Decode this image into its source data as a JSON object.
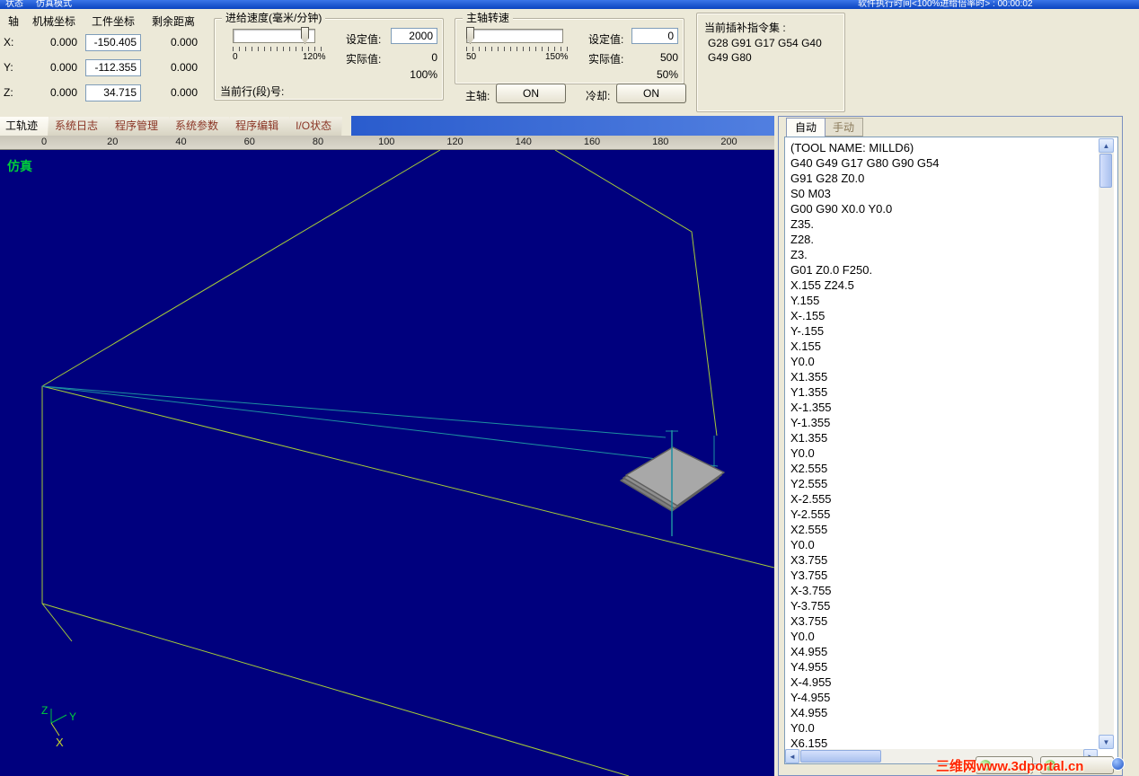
{
  "titlebar": {
    "status": "状态",
    "mode": "仿真模式",
    "exec_info": "软件执行时间<100%进给倍率时> : 00:00:02"
  },
  "coords": {
    "headers": [
      "轴",
      "机械坐标",
      "工件坐标",
      "剩余距离"
    ],
    "rows": [
      {
        "axis": "X:",
        "machine": "0.000",
        "work": "-150.405",
        "remain": "0.000"
      },
      {
        "axis": "Y:",
        "machine": "0.000",
        "work": "-112.355",
        "remain": "0.000"
      },
      {
        "axis": "Z:",
        "machine": "0.000",
        "work": "34.715",
        "remain": "0.000"
      }
    ]
  },
  "feed": {
    "title": "进给速度(毫米/分钟)",
    "slider_min": "0",
    "slider_max": "120%",
    "set_label": "设定值:",
    "set_value": "2000",
    "actual_label": "实际值:",
    "actual_value": "0",
    "percent": "100%",
    "current_line_label": "当前行(段)号:"
  },
  "spindle": {
    "title": "主轴转速",
    "slider_min": "50",
    "slider_max": "150%",
    "set_label": "设定值:",
    "set_value": "0",
    "actual_label": "实际值:",
    "actual_value": "500",
    "percent": "50%",
    "spindle_label": "主轴:",
    "spindle_btn": "ON",
    "coolant_label": "冷却:",
    "coolant_btn": "ON"
  },
  "gcode_panel": {
    "title": "当前插补指令集 :",
    "lines": [
      "G28 G91 G17 G54 G40",
      "G49 G80"
    ]
  },
  "main_tabs": {
    "items": [
      "工轨迹",
      "系统日志",
      "程序管理",
      "系统参数",
      "程序编辑",
      "I/O状态"
    ],
    "active": "工轨迹"
  },
  "viewport": {
    "mode_label": "仿真",
    "ruler_values": [
      0,
      20,
      40,
      60,
      80,
      100,
      120,
      140,
      160,
      180,
      200
    ],
    "axis_labels": {
      "x": "X",
      "y": "Y",
      "z": "Z"
    },
    "colors": {
      "background": "#00007e",
      "wireframe": "#a6cc38",
      "toolpath": "#1d8fa0",
      "part_fill": "#a8a8a8",
      "label_green": "#00d03a"
    }
  },
  "right_panel": {
    "tabs": [
      "自动",
      "手动"
    ],
    "active_tab": "自动",
    "gcode_lines": [
      "(TOOL NAME: MILLD6)",
      "G40 G49 G17 G80 G90 G54",
      "G91 G28 Z0.0",
      "S0 M03",
      "G00 G90 X0.0 Y0.0",
      "Z35.",
      "Z28.",
      "Z3.",
      "G01 Z0.0 F250.",
      "X.155 Z24.5",
      "Y.155",
      "X-.155",
      "Y-.155",
      "X.155",
      "Y0.0",
      "X1.355",
      "Y1.355",
      "X-1.355",
      "Y-1.355",
      "X1.355",
      "Y0.0",
      "X2.555",
      "Y2.555",
      "X-2.555",
      "Y-2.555",
      "X2.555",
      "Y0.0",
      "X3.755",
      "Y3.755",
      "X-3.755",
      "Y-3.755",
      "X3.755",
      "Y0.0",
      "X4.955",
      "Y4.955",
      "X-4.955",
      "Y-4.955",
      "X4.955",
      "Y0.0",
      "X6.155"
    ],
    "watermark": "三维网www.3dportal.cn"
  }
}
